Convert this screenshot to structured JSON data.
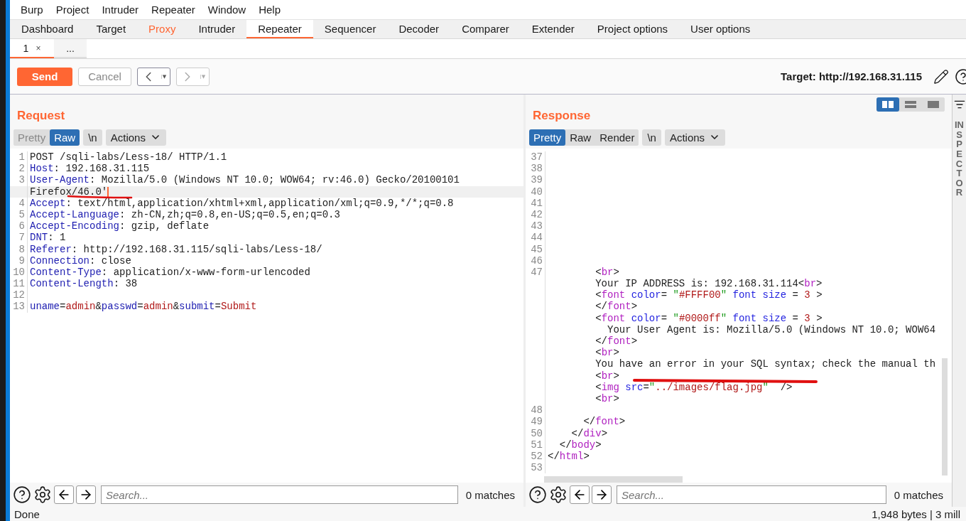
{
  "menu": [
    "Burp",
    "Project",
    "Intruder",
    "Repeater",
    "Window",
    "Help"
  ],
  "tabs": [
    {
      "label": "Dashboard",
      "selected": false,
      "highlighted": false
    },
    {
      "label": "Target",
      "selected": false,
      "highlighted": false
    },
    {
      "label": "Proxy",
      "selected": false,
      "highlighted": true
    },
    {
      "label": "Intruder",
      "selected": false,
      "highlighted": false
    },
    {
      "label": "Repeater",
      "selected": true,
      "highlighted": false
    },
    {
      "label": "Sequencer",
      "selected": false,
      "highlighted": false
    },
    {
      "label": "Decoder",
      "selected": false,
      "highlighted": false
    },
    {
      "label": "Comparer",
      "selected": false,
      "highlighted": false
    },
    {
      "label": "Extender",
      "selected": false,
      "highlighted": false
    },
    {
      "label": "Project options",
      "selected": false,
      "highlighted": false
    },
    {
      "label": "User options",
      "selected": false,
      "highlighted": false
    }
  ],
  "subtabs": [
    {
      "label": "1",
      "close": "×",
      "selected": true
    },
    {
      "label": "...",
      "selected": false
    }
  ],
  "toolbar": {
    "send": "Send",
    "cancel": {
      "label": "Cancel",
      "disabled": true
    },
    "history_nav": [
      {
        "kind": "back",
        "disabled": false
      },
      {
        "kind": "forward",
        "disabled": true
      }
    ],
    "target": "Target: http://192.168.31.115"
  },
  "view_modes": [
    {
      "kind": "columns",
      "selected": true
    },
    {
      "kind": "rows",
      "selected": false
    },
    {
      "kind": "single",
      "selected": false
    }
  ],
  "request": {
    "title": "Request",
    "view_tabs": [
      {
        "label": "Pretty",
        "selected": false,
        "disabled": true
      },
      {
        "label": "Raw",
        "selected": true,
        "disabled": false
      }
    ],
    "newline": "\\n",
    "actions": "Actions",
    "rows": [
      {
        "number": "1",
        "current": false,
        "tokens": [
          {
            "kind": "plain",
            "text": "POST /sqli-labs/Less-18/ HTTP/1.1"
          }
        ]
      },
      {
        "number": "2",
        "current": false,
        "tokens": [
          {
            "kind": "name",
            "text": "Host"
          },
          {
            "kind": "plain",
            "text": ": 192.168.31.115"
          }
        ]
      },
      {
        "number": "3",
        "current": false,
        "tokens": [
          {
            "kind": "name",
            "text": "User-Agent"
          },
          {
            "kind": "plain",
            "text": ": Mozilla/5.0 (Windows NT 10.0; WOW64; rv:46.0) Gecko/20100101"
          }
        ]
      },
      {
        "current": true,
        "tokens": [
          {
            "kind": "plain",
            "text": "Firefox/46.0'"
          }
        ]
      },
      {
        "number": "4",
        "current": false,
        "tokens": [
          {
            "kind": "name",
            "text": "Accept"
          },
          {
            "kind": "plain",
            "text": ": text/html,application/xhtml+xml,application/xml;q=0.9,*/*;q=0.8"
          }
        ]
      },
      {
        "number": "5",
        "current": false,
        "tokens": [
          {
            "kind": "name",
            "text": "Accept-Language"
          },
          {
            "kind": "plain",
            "text": ": zh-CN,zh;q=0.8,en-US;q=0.5,en;q=0.3"
          }
        ]
      },
      {
        "number": "6",
        "current": false,
        "tokens": [
          {
            "kind": "name",
            "text": "Accept-Encoding"
          },
          {
            "kind": "plain",
            "text": ": gzip, deflate"
          }
        ]
      },
      {
        "number": "7",
        "current": false,
        "tokens": [
          {
            "kind": "name",
            "text": "DNT"
          },
          {
            "kind": "plain",
            "text": ": 1"
          }
        ]
      },
      {
        "number": "8",
        "current": false,
        "tokens": [
          {
            "kind": "name",
            "text": "Referer"
          },
          {
            "kind": "plain",
            "text": ": http://192.168.31.115/sqli-labs/Less-18/"
          }
        ]
      },
      {
        "number": "9",
        "current": false,
        "tokens": [
          {
            "kind": "name",
            "text": "Connection"
          },
          {
            "kind": "plain",
            "text": ": close"
          }
        ]
      },
      {
        "number": "10",
        "current": false,
        "tokens": [
          {
            "kind": "name",
            "text": "Content-Type"
          },
          {
            "kind": "plain",
            "text": ": application/x-www-form-urlencoded"
          }
        ]
      },
      {
        "number": "11",
        "current": false,
        "tokens": [
          {
            "kind": "name",
            "text": "Content-Length"
          },
          {
            "kind": "plain",
            "text": ": 38"
          }
        ]
      },
      {
        "number": "12",
        "current": false,
        "tokens": []
      },
      {
        "number": "13",
        "current": false,
        "tokens": [
          {
            "kind": "name",
            "text": "uname"
          },
          {
            "kind": "plain",
            "text": "="
          },
          {
            "kind": "value",
            "text": "admin"
          },
          {
            "kind": "plain",
            "text": "&"
          },
          {
            "kind": "name",
            "text": "passwd"
          },
          {
            "kind": "plain",
            "text": "="
          },
          {
            "kind": "value",
            "text": "admin"
          },
          {
            "kind": "plain",
            "text": "&"
          },
          {
            "kind": "name",
            "text": "submit"
          },
          {
            "kind": "plain",
            "text": "="
          },
          {
            "kind": "value",
            "text": "Submit"
          }
        ]
      }
    ],
    "search": {
      "placeholder": "Search...",
      "matches": "0 matches"
    }
  },
  "response": {
    "title": "Response",
    "view_tabs": [
      {
        "label": "Pretty",
        "selected": true,
        "disabled": false
      },
      {
        "label": "Raw",
        "selected": false,
        "disabled": false
      },
      {
        "label": "Render",
        "selected": false,
        "disabled": false
      }
    ],
    "newline": "\\n",
    "actions": "Actions",
    "rows": [
      {
        "number": "37",
        "tokens": []
      },
      {
        "number": "38",
        "tokens": []
      },
      {
        "number": "39",
        "tokens": []
      },
      {
        "number": "40",
        "tokens": []
      },
      {
        "number": "41",
        "tokens": []
      },
      {
        "number": "42",
        "tokens": []
      },
      {
        "number": "43",
        "tokens": []
      },
      {
        "number": "44",
        "tokens": []
      },
      {
        "number": "45",
        "tokens": []
      },
      {
        "number": "46",
        "tokens": []
      },
      {
        "number": "47",
        "tokens": [
          {
            "kind": "plain",
            "text": "        <"
          },
          {
            "kind": "tag",
            "text": "br"
          },
          {
            "kind": "plain",
            "text": ">"
          }
        ]
      },
      {
        "tokens": [
          {
            "kind": "plain",
            "text": "        Your IP ADDRESS is: 192.168.31.114<"
          },
          {
            "kind": "tag",
            "text": "br"
          },
          {
            "kind": "plain",
            "text": ">"
          }
        ]
      },
      {
        "tokens": [
          {
            "kind": "plain",
            "text": "        <"
          },
          {
            "kind": "tag",
            "text": "font"
          },
          {
            "kind": "attr",
            "text": " color"
          },
          {
            "kind": "plain",
            "text": "= "
          },
          {
            "kind": "quote",
            "text": "\""
          },
          {
            "kind": "value",
            "text": "#FFFF00"
          },
          {
            "kind": "quote",
            "text": "\""
          },
          {
            "kind": "attr",
            "text": " font size"
          },
          {
            "kind": "plain",
            "text": " = "
          },
          {
            "kind": "value",
            "text": "3"
          },
          {
            "kind": "plain",
            "text": " >"
          }
        ]
      },
      {
        "tokens": [
          {
            "kind": "plain",
            "text": "        </"
          },
          {
            "kind": "tag",
            "text": "font"
          },
          {
            "kind": "plain",
            "text": ">"
          }
        ]
      },
      {
        "tokens": [
          {
            "kind": "plain",
            "text": "        <"
          },
          {
            "kind": "tag",
            "text": "font"
          },
          {
            "kind": "attr",
            "text": " color"
          },
          {
            "kind": "plain",
            "text": "= "
          },
          {
            "kind": "quote",
            "text": "\""
          },
          {
            "kind": "value",
            "text": "#0000ff"
          },
          {
            "kind": "quote",
            "text": "\""
          },
          {
            "kind": "attr",
            "text": " font size"
          },
          {
            "kind": "plain",
            "text": " = "
          },
          {
            "kind": "value",
            "text": "3"
          },
          {
            "kind": "plain",
            "text": " >"
          }
        ]
      },
      {
        "tokens": [
          {
            "kind": "plain",
            "text": "          Your User Agent is: Mozilla/5.0 (Windows NT 10.0; WOW64"
          }
        ]
      },
      {
        "tokens": [
          {
            "kind": "plain",
            "text": "        </"
          },
          {
            "kind": "tag",
            "text": "font"
          },
          {
            "kind": "plain",
            "text": ">"
          }
        ]
      },
      {
        "tokens": [
          {
            "kind": "plain",
            "text": "        <"
          },
          {
            "kind": "tag",
            "text": "br"
          },
          {
            "kind": "plain",
            "text": ">"
          }
        ]
      },
      {
        "tokens": [
          {
            "kind": "plain",
            "text": "        You have an error in your SQL syntax; check the manual th"
          }
        ]
      },
      {
        "tokens": [
          {
            "kind": "plain",
            "text": "        <"
          },
          {
            "kind": "tag",
            "text": "br"
          },
          {
            "kind": "plain",
            "text": ">"
          }
        ]
      },
      {
        "tokens": [
          {
            "kind": "plain",
            "text": "        <"
          },
          {
            "kind": "tag",
            "text": "img"
          },
          {
            "kind": "attr",
            "text": " src"
          },
          {
            "kind": "plain",
            "text": "="
          },
          {
            "kind": "quote",
            "text": "\""
          },
          {
            "kind": "value",
            "text": "../images/flag.jpg"
          },
          {
            "kind": "quote",
            "text": "\""
          },
          {
            "kind": "plain",
            "text": "  />"
          }
        ]
      },
      {
        "tokens": [
          {
            "kind": "plain",
            "text": "        <"
          },
          {
            "kind": "tag",
            "text": "br"
          },
          {
            "kind": "plain",
            "text": ">"
          }
        ]
      },
      {
        "number": "48",
        "tokens": []
      },
      {
        "number": "49",
        "tokens": [
          {
            "kind": "plain",
            "text": "      </"
          },
          {
            "kind": "tag",
            "text": "font"
          },
          {
            "kind": "plain",
            "text": ">"
          }
        ]
      },
      {
        "number": "50",
        "tokens": [
          {
            "kind": "plain",
            "text": "    </"
          },
          {
            "kind": "tag",
            "text": "div"
          },
          {
            "kind": "plain",
            "text": ">"
          }
        ]
      },
      {
        "number": "51",
        "tokens": [
          {
            "kind": "plain",
            "text": "  </"
          },
          {
            "kind": "tag",
            "text": "body"
          },
          {
            "kind": "plain",
            "text": ">"
          }
        ]
      },
      {
        "number": "52",
        "tokens": [
          {
            "kind": "plain",
            "text": "</"
          },
          {
            "kind": "tag",
            "text": "html"
          },
          {
            "kind": "plain",
            "text": ">"
          }
        ]
      },
      {
        "number": "53",
        "tokens": []
      }
    ],
    "search": {
      "placeholder": "Search...",
      "matches": "0 matches"
    }
  },
  "inspector": "INSPECTOR",
  "status": {
    "left": "Done",
    "right": "1,948 bytes | 3 mill"
  }
}
